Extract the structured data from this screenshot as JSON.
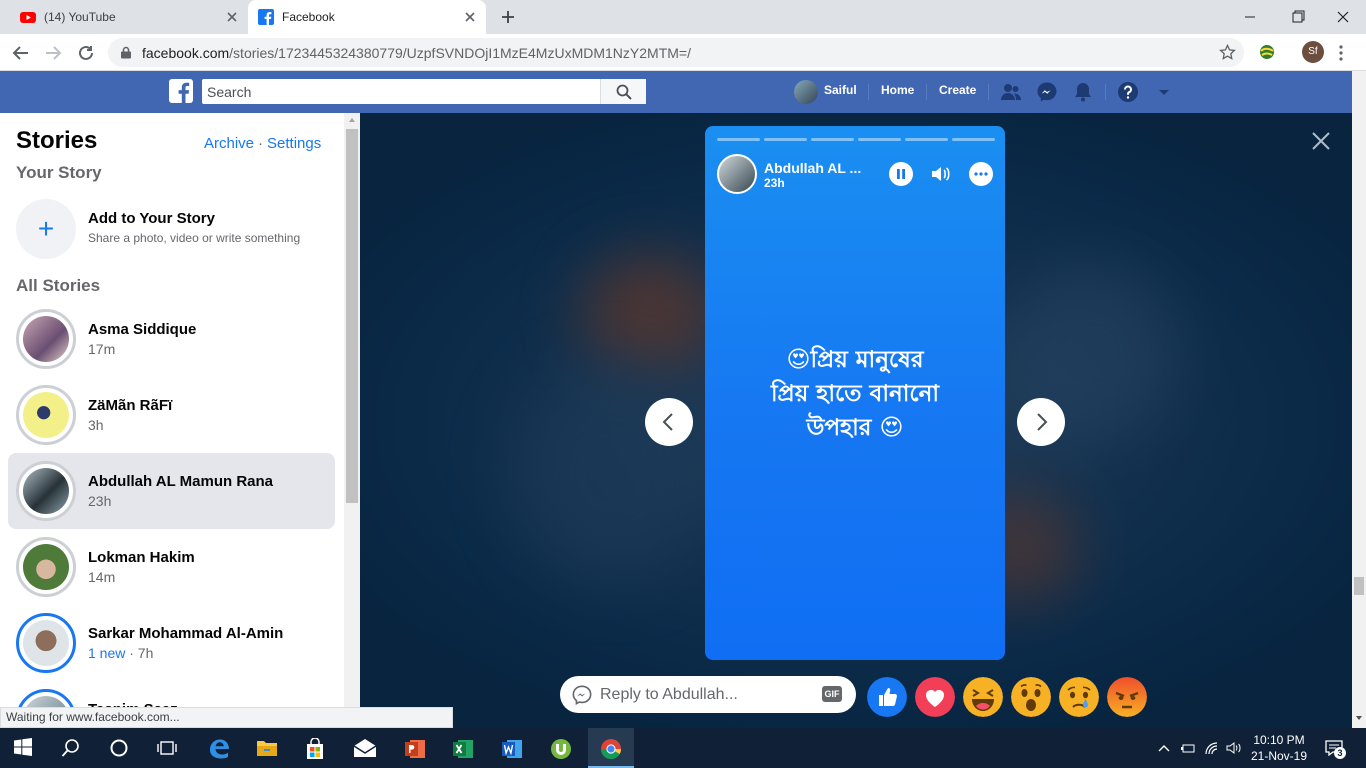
{
  "browser": {
    "tabs": [
      {
        "title": "(14) YouTube",
        "icon": "youtube-icon"
      },
      {
        "title": "Facebook",
        "icon": "facebook-icon",
        "active": true
      }
    ],
    "address": {
      "host": "facebook.com",
      "path": "/stories/1723445324380779/UzpfSVNDOjI1MzE4MzUxMDM1NzY2MTM=/"
    },
    "profile_initials": "Sf",
    "status_text": "Waiting for www.facebook.com..."
  },
  "fb_header": {
    "search_placeholder": "Search",
    "user_name": "Saiful",
    "home": "Home",
    "create": "Create",
    "brand_color": "#4267b2"
  },
  "stories_panel": {
    "title": "Stories",
    "archive": "Archive",
    "separator": "·",
    "settings": "Settings",
    "your_story": "Your Story",
    "add_title": "Add to Your Story",
    "add_subtitle": "Share a photo, video or write something",
    "all_stories": "All Stories",
    "items": [
      {
        "name": "Asma Siddique",
        "time": "17m"
      },
      {
        "name": "ZäMãn RãFï",
        "time": "3h"
      },
      {
        "name": "Abdullah AL Mamun Rana",
        "time": "23h",
        "active": true
      },
      {
        "name": "Lokman Hakim",
        "time": "14m"
      },
      {
        "name": "Sarkar Mohammad Al-Amin",
        "new_label": "1 new",
        "time": "· 7h"
      },
      {
        "name": "Tasnim Saaz",
        "time": ""
      }
    ]
  },
  "viewer": {
    "author": "Abdullah AL ...",
    "time": "23h",
    "segments": 6,
    "segments_done": 0,
    "story_text": "😍প্রিয় মানুষের\nপ্রিয় হাতে বানানো\nউপহার 😍",
    "reply_placeholder": "Reply to Abdullah...",
    "gif_label": "GIF",
    "reactions": [
      "like",
      "love",
      "haha",
      "wow",
      "sad",
      "angry"
    ]
  },
  "taskbar": {
    "time": "10:10 PM",
    "date": "21-Nov-19",
    "notification_count": "3"
  }
}
